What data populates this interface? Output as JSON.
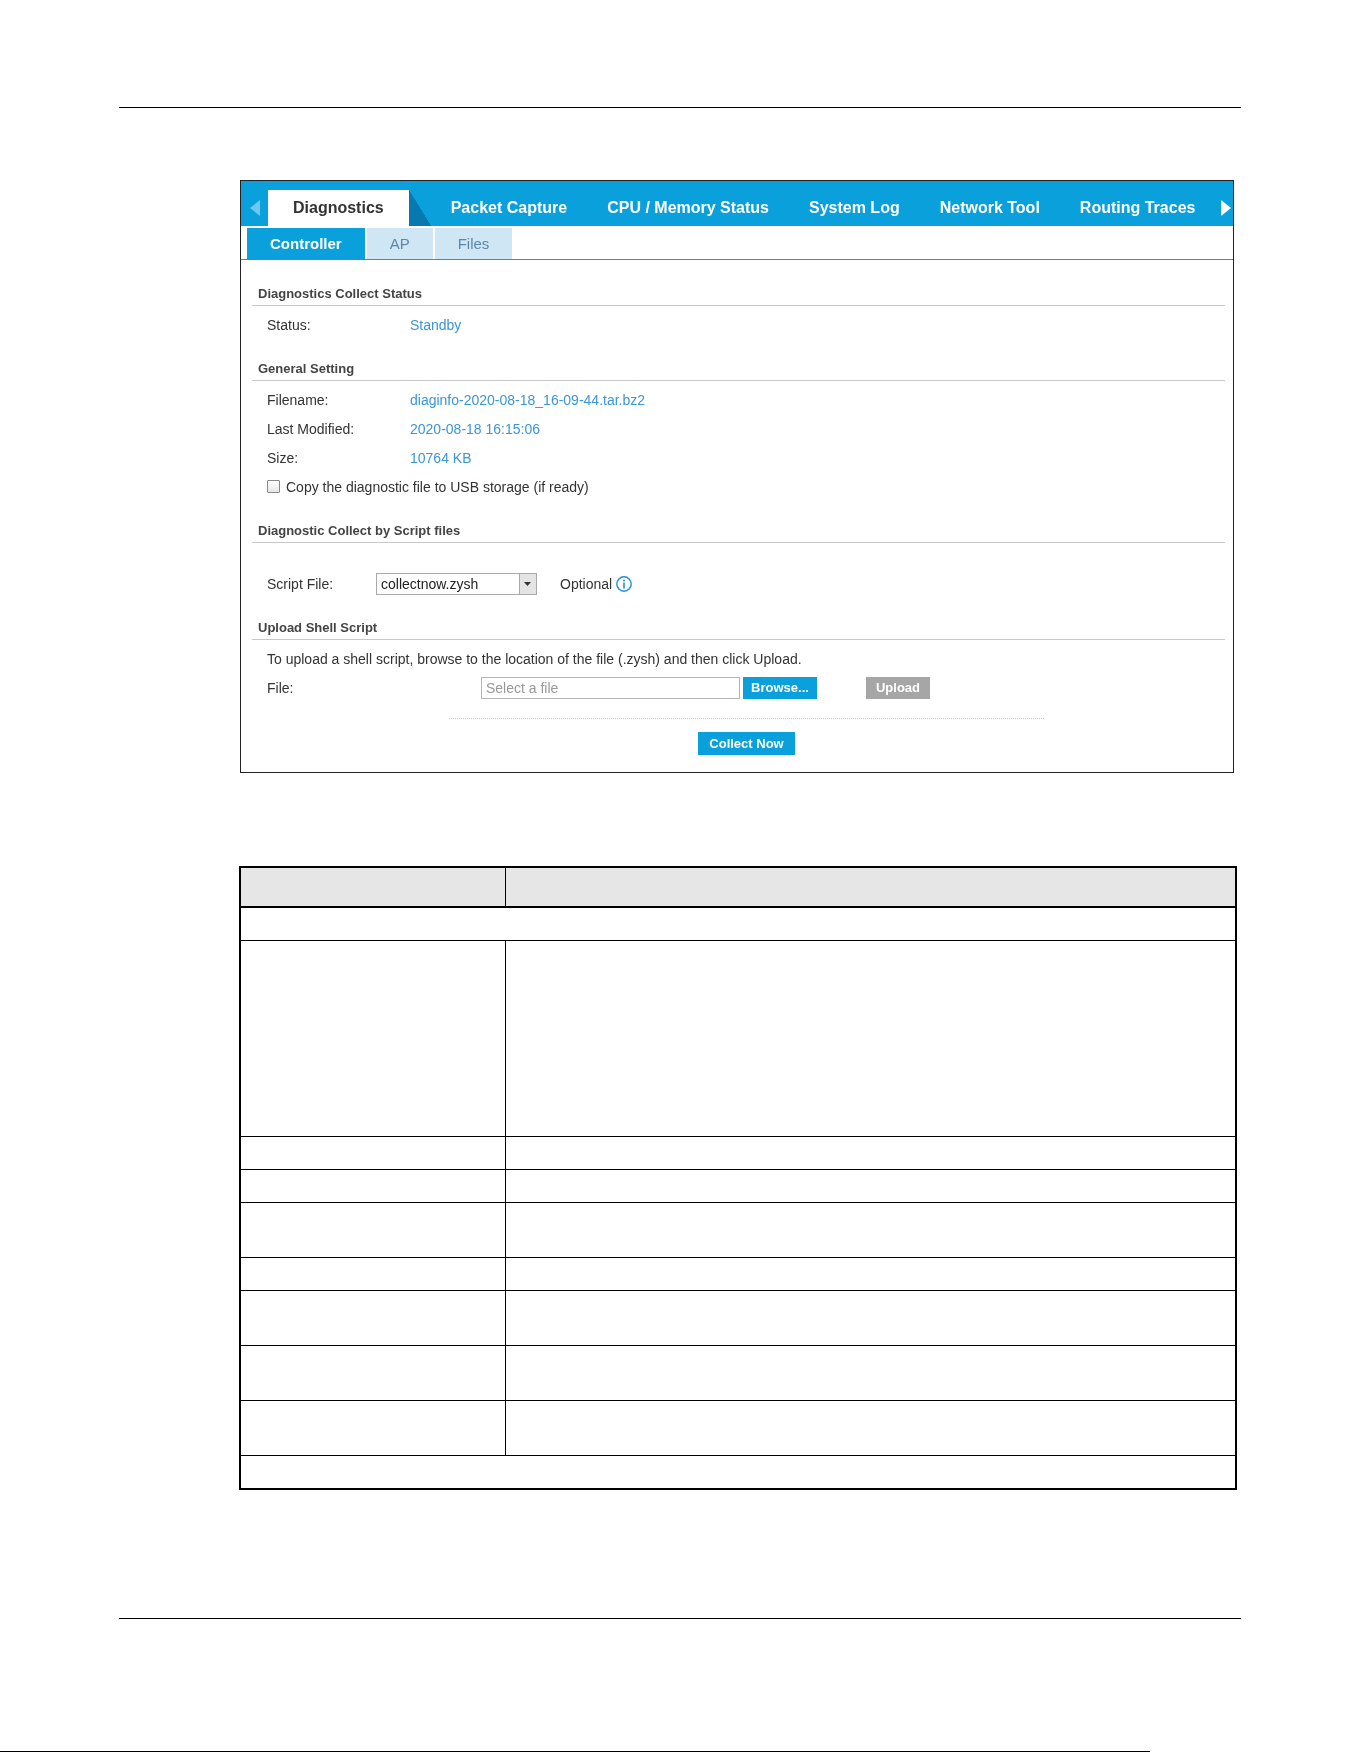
{
  "tab_bar": {
    "scroll_left": {
      "disabled": true
    },
    "tabs": [
      {
        "label": "Diagnostics",
        "selected": true
      },
      {
        "label": "Packet Capture",
        "selected": false
      },
      {
        "label": "CPU / Memory Status",
        "selected": false
      },
      {
        "label": "System Log",
        "selected": false
      },
      {
        "label": "Network Tool",
        "selected": false
      },
      {
        "label": "Routing Traces",
        "selected": false
      }
    ],
    "scroll_right": {
      "disabled": false
    }
  },
  "sub_tabs": [
    {
      "label": "Controller",
      "selected": true
    },
    {
      "label": "AP",
      "selected": false
    },
    {
      "label": "Files",
      "selected": false
    }
  ],
  "sections": [
    {
      "title": "Diagnostics Collect Status",
      "rows": [
        {
          "kind": "value",
          "label": "Status:",
          "value": "Standby"
        }
      ]
    },
    {
      "title": "General Setting",
      "rows": [
        {
          "kind": "value",
          "label": "Filename:",
          "value": "diaginfo-2020-08-18_16-09-44.tar.bz2"
        },
        {
          "kind": "value",
          "label": "Last Modified:",
          "value": "2020-08-18 16:15:06"
        },
        {
          "kind": "value",
          "label": "Size:",
          "value": "10764 KB"
        },
        {
          "kind": "checkbox",
          "label": "Copy the diagnostic file to USB storage (if ready)",
          "checked": false
        }
      ]
    },
    {
      "title": "Diagnostic Collect by Script files",
      "rows": [
        {
          "kind": "select",
          "label": "Script File:",
          "value": "collectnow.zysh",
          "note": "Optional"
        }
      ]
    },
    {
      "title": "Upload Shell Script",
      "rows": [
        {
          "kind": "text",
          "text": "To upload a shell script, browse to the location of the file (.zysh) and then click Upload."
        },
        {
          "kind": "file",
          "label": "File:",
          "placeholder": "Select a file",
          "browse": {
            "label": "Browse...",
            "disabled": false
          },
          "upload": {
            "label": "Upload",
            "disabled": true
          }
        }
      ]
    }
  ],
  "collect_button": {
    "label": "Collect Now"
  },
  "table": {
    "rows": [
      {
        "kind": "header"
      },
      {
        "kind": "banner"
      },
      {
        "kind": "tall"
      },
      {
        "kind": "single"
      },
      {
        "kind": "single"
      },
      {
        "kind": "double"
      },
      {
        "kind": "single"
      },
      {
        "kind": "double"
      },
      {
        "kind": "double"
      },
      {
        "kind": "double"
      },
      {
        "kind": "banner"
      }
    ]
  }
}
